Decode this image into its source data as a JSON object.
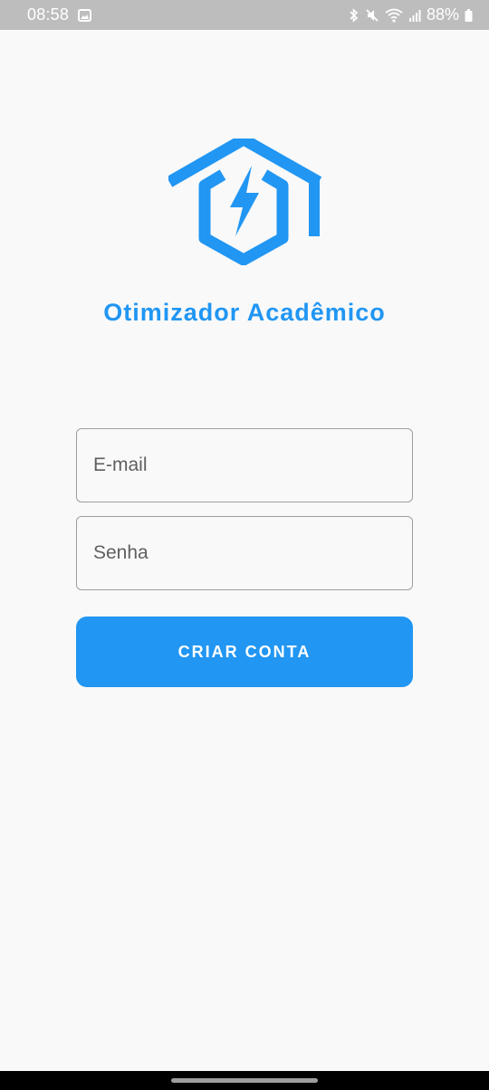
{
  "status_bar": {
    "time": "08:58",
    "battery": "88%"
  },
  "app": {
    "title": "Otimizador Acadêmico"
  },
  "form": {
    "email_placeholder": "E-mail",
    "password_placeholder": "Senha",
    "submit_label": "CRIAR CONTA"
  },
  "colors": {
    "accent": "#2196f3",
    "status_bar_bg": "#bdbdbd",
    "background": "#f9f9f9"
  },
  "icons": {
    "logo": "graduation-cap-lightning-icon",
    "status": [
      "gallery-icon",
      "bluetooth-icon",
      "mute-icon",
      "wifi-icon",
      "signal-icon",
      "battery-icon"
    ]
  }
}
